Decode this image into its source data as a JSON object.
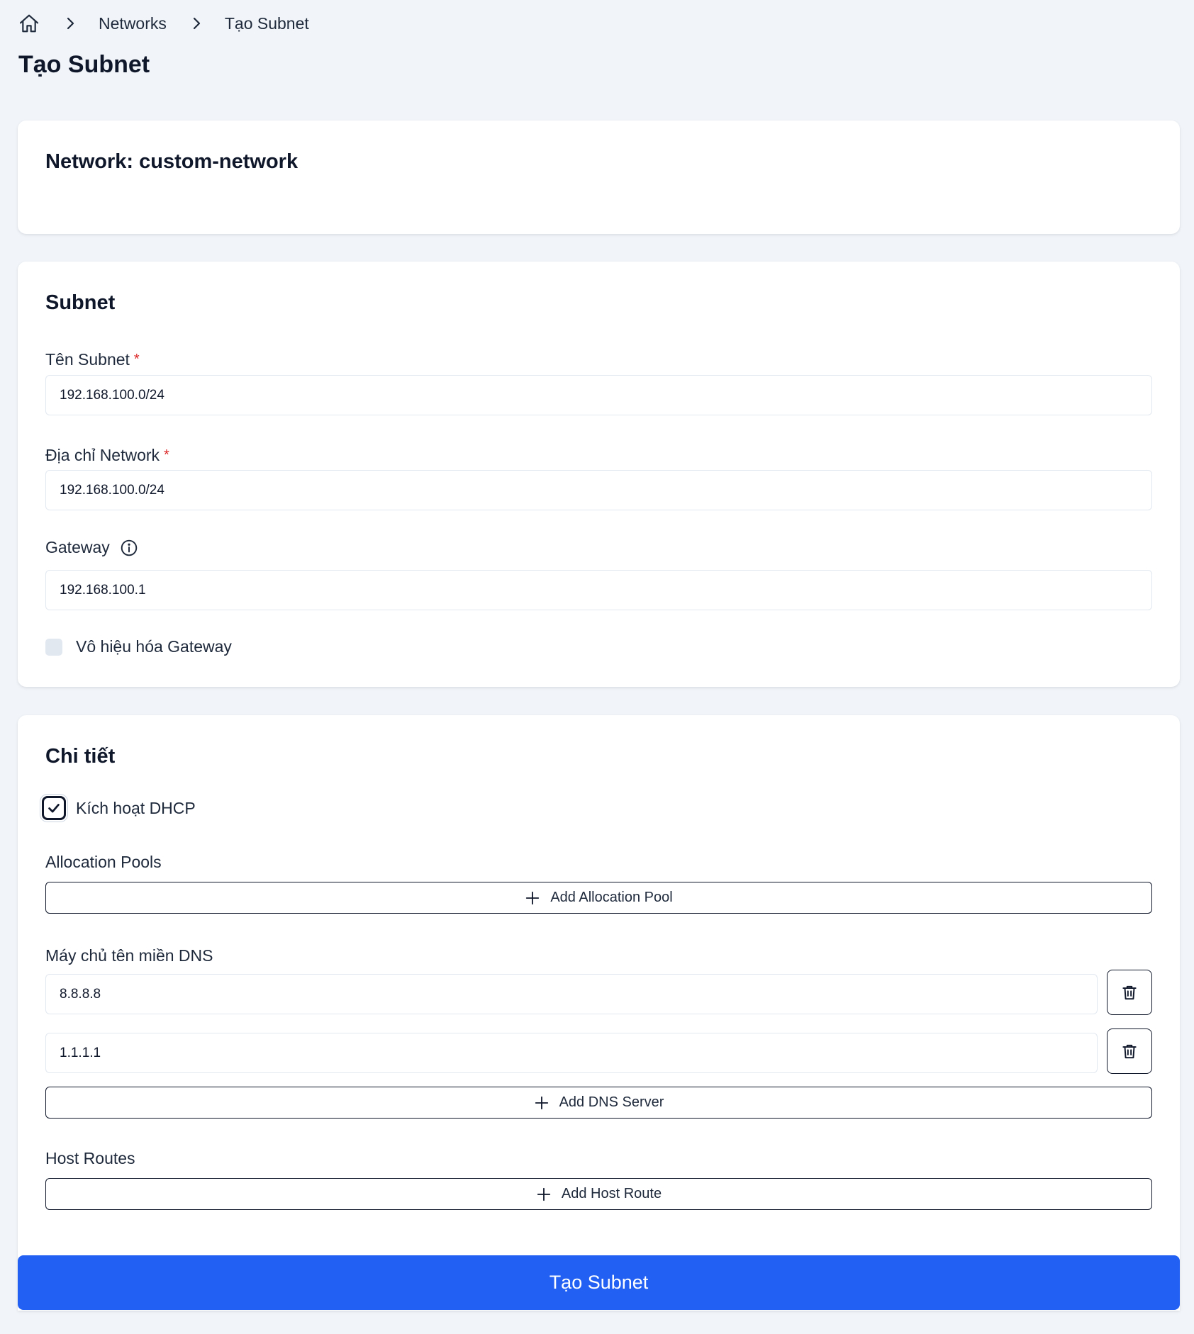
{
  "breadcrumb": {
    "items": [
      {
        "label": "Networks"
      },
      {
        "label": "Tạo Subnet"
      }
    ]
  },
  "page_title": "Tạo Subnet",
  "network_card": {
    "title": "Network: custom-network"
  },
  "subnet_card": {
    "heading": "Subnet",
    "name_label": "Tên Subnet",
    "name_value": "192.168.100.0/24",
    "address_label": "Địa chỉ Network",
    "address_value": "192.168.100.0/24",
    "gateway_label": "Gateway",
    "gateway_value": "192.168.100.1",
    "required_mark": "*",
    "disable_gateway_label": "Vô hiệu hóa Gateway",
    "disable_gateway_checked": false
  },
  "detail_card": {
    "heading": "Chi tiết",
    "dhcp_label": "Kích hoạt DHCP",
    "dhcp_checked": true,
    "allocation_pools_label": "Allocation Pools",
    "add_allocation_pool": "Add Allocation Pool",
    "dns_label": "Máy chủ tên miền DNS",
    "dns_servers": [
      "8.8.8.8",
      "1.1.1.1"
    ],
    "add_dns_server": "Add DNS Server",
    "host_routes_label": "Host Routes",
    "add_host_route": "Add Host Route"
  },
  "submit_label": "Tạo Subnet",
  "colors": {
    "primary": "#2160f3",
    "background": "#f1f5f9",
    "required": "#dc2626",
    "text": "#0f172a"
  },
  "icons": {
    "home": "home-icon",
    "separator": "chevron-right-icon",
    "info": "info-icon",
    "plus": "plus-icon",
    "trash": "trash-icon",
    "check": "check-icon"
  }
}
